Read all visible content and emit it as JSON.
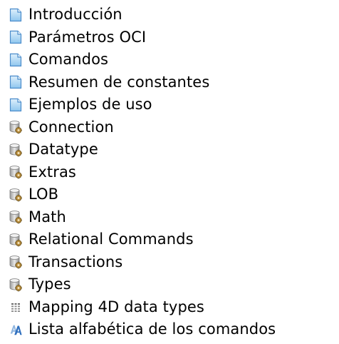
{
  "tree": {
    "items": [
      {
        "label": "Introducción",
        "icon": "document-icon"
      },
      {
        "label": "Parámetros OCI",
        "icon": "document-icon"
      },
      {
        "label": "Comandos",
        "icon": "document-icon"
      },
      {
        "label": "Resumen de constantes",
        "icon": "document-icon"
      },
      {
        "label": "Ejemplos de uso",
        "icon": "document-icon"
      },
      {
        "label": "Connection",
        "icon": "database-gear-icon"
      },
      {
        "label": "Datatype",
        "icon": "database-gear-icon"
      },
      {
        "label": "Extras",
        "icon": "database-gear-icon"
      },
      {
        "label": "LOB",
        "icon": "database-gear-icon"
      },
      {
        "label": "Math",
        "icon": "database-gear-icon"
      },
      {
        "label": "Relational Commands",
        "icon": "database-gear-icon"
      },
      {
        "label": "Transactions",
        "icon": "database-gear-icon"
      },
      {
        "label": "Types",
        "icon": "database-gear-icon"
      },
      {
        "label": "Mapping 4D data types",
        "icon": "table-list-icon"
      },
      {
        "label": "Lista alfabética de los comandos",
        "icon": "alphabetical-index-icon"
      }
    ]
  }
}
